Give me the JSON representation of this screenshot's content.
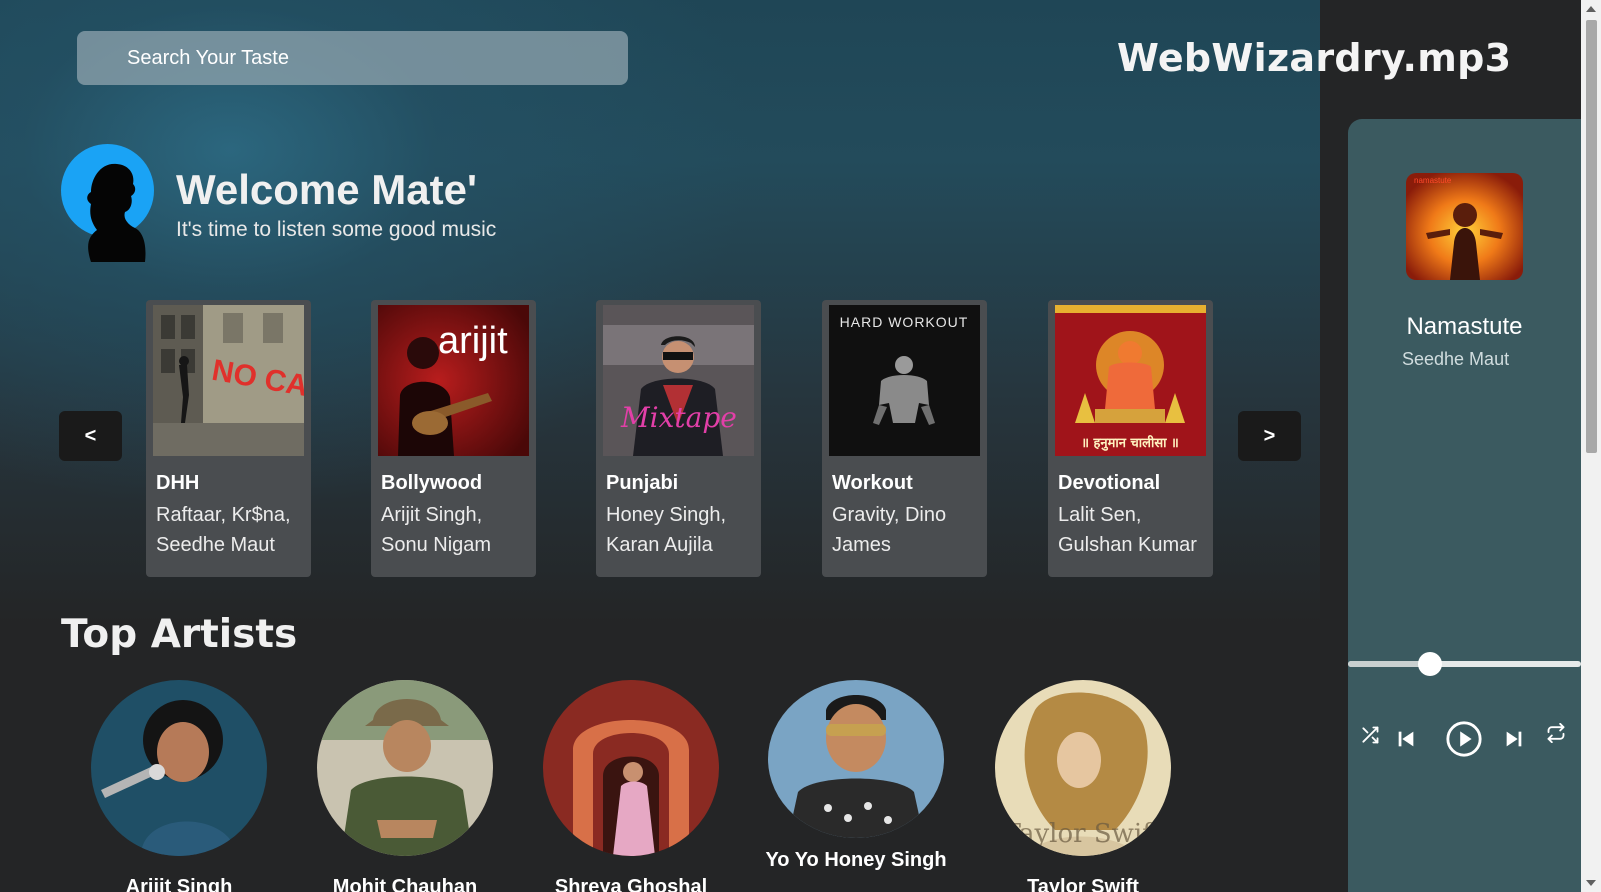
{
  "app": {
    "logo": "WebWizardry.mp3",
    "accent": "#3b5a60"
  },
  "search": {
    "placeholder": "Search Your Taste",
    "icon": "search-field"
  },
  "welcome": {
    "title": "Welcome Mate'",
    "subtitle": "It's time to listen some good music",
    "avatar_icon": "user-silhouette-icon"
  },
  "carousel": {
    "prev_label": "<",
    "next_label": ">",
    "cards": [
      {
        "name": "DHH",
        "artists": "Raftaar, Kr$na, Seedhe Maut",
        "art_icon": "no-cap-cover"
      },
      {
        "name": "Bollywood",
        "artists": "Arijit Singh, Sonu Nigam",
        "art_icon": "arijit-cover"
      },
      {
        "name": "Punjabi",
        "artists": "Honey Singh, Karan Aujila",
        "art_icon": "mixtape-cover"
      },
      {
        "name": "Workout",
        "artists": "Gravity, Dino James",
        "art_icon": "hard-workout-cover"
      },
      {
        "name": "Devotional",
        "artists": "Lalit Sen, Gulshan Kumar",
        "art_icon": "hanuman-chalisa-cover"
      }
    ],
    "cover_texts": {
      "workout": "HARD WORKOUT",
      "arijit": "arijit",
      "mixtape": "Mixtape",
      "nocap": "NO CAP",
      "hanuman": "॥ हनुमान चालीसा ॥"
    }
  },
  "top_artists": {
    "title": "Top Artists",
    "items": [
      {
        "name": "Arijit Singh"
      },
      {
        "name": "Mohit Chauhan"
      },
      {
        "name": "Shreya Ghoshal"
      },
      {
        "name": "Yo Yo Honey Singh"
      },
      {
        "name": "Taylor Swift"
      }
    ]
  },
  "player": {
    "song": "Namastute",
    "artist": "Seedhe Maut",
    "progress": 0.35,
    "controls": [
      "shuffle-icon",
      "previous-icon",
      "play-icon",
      "next-icon",
      "repeat-icon"
    ]
  }
}
